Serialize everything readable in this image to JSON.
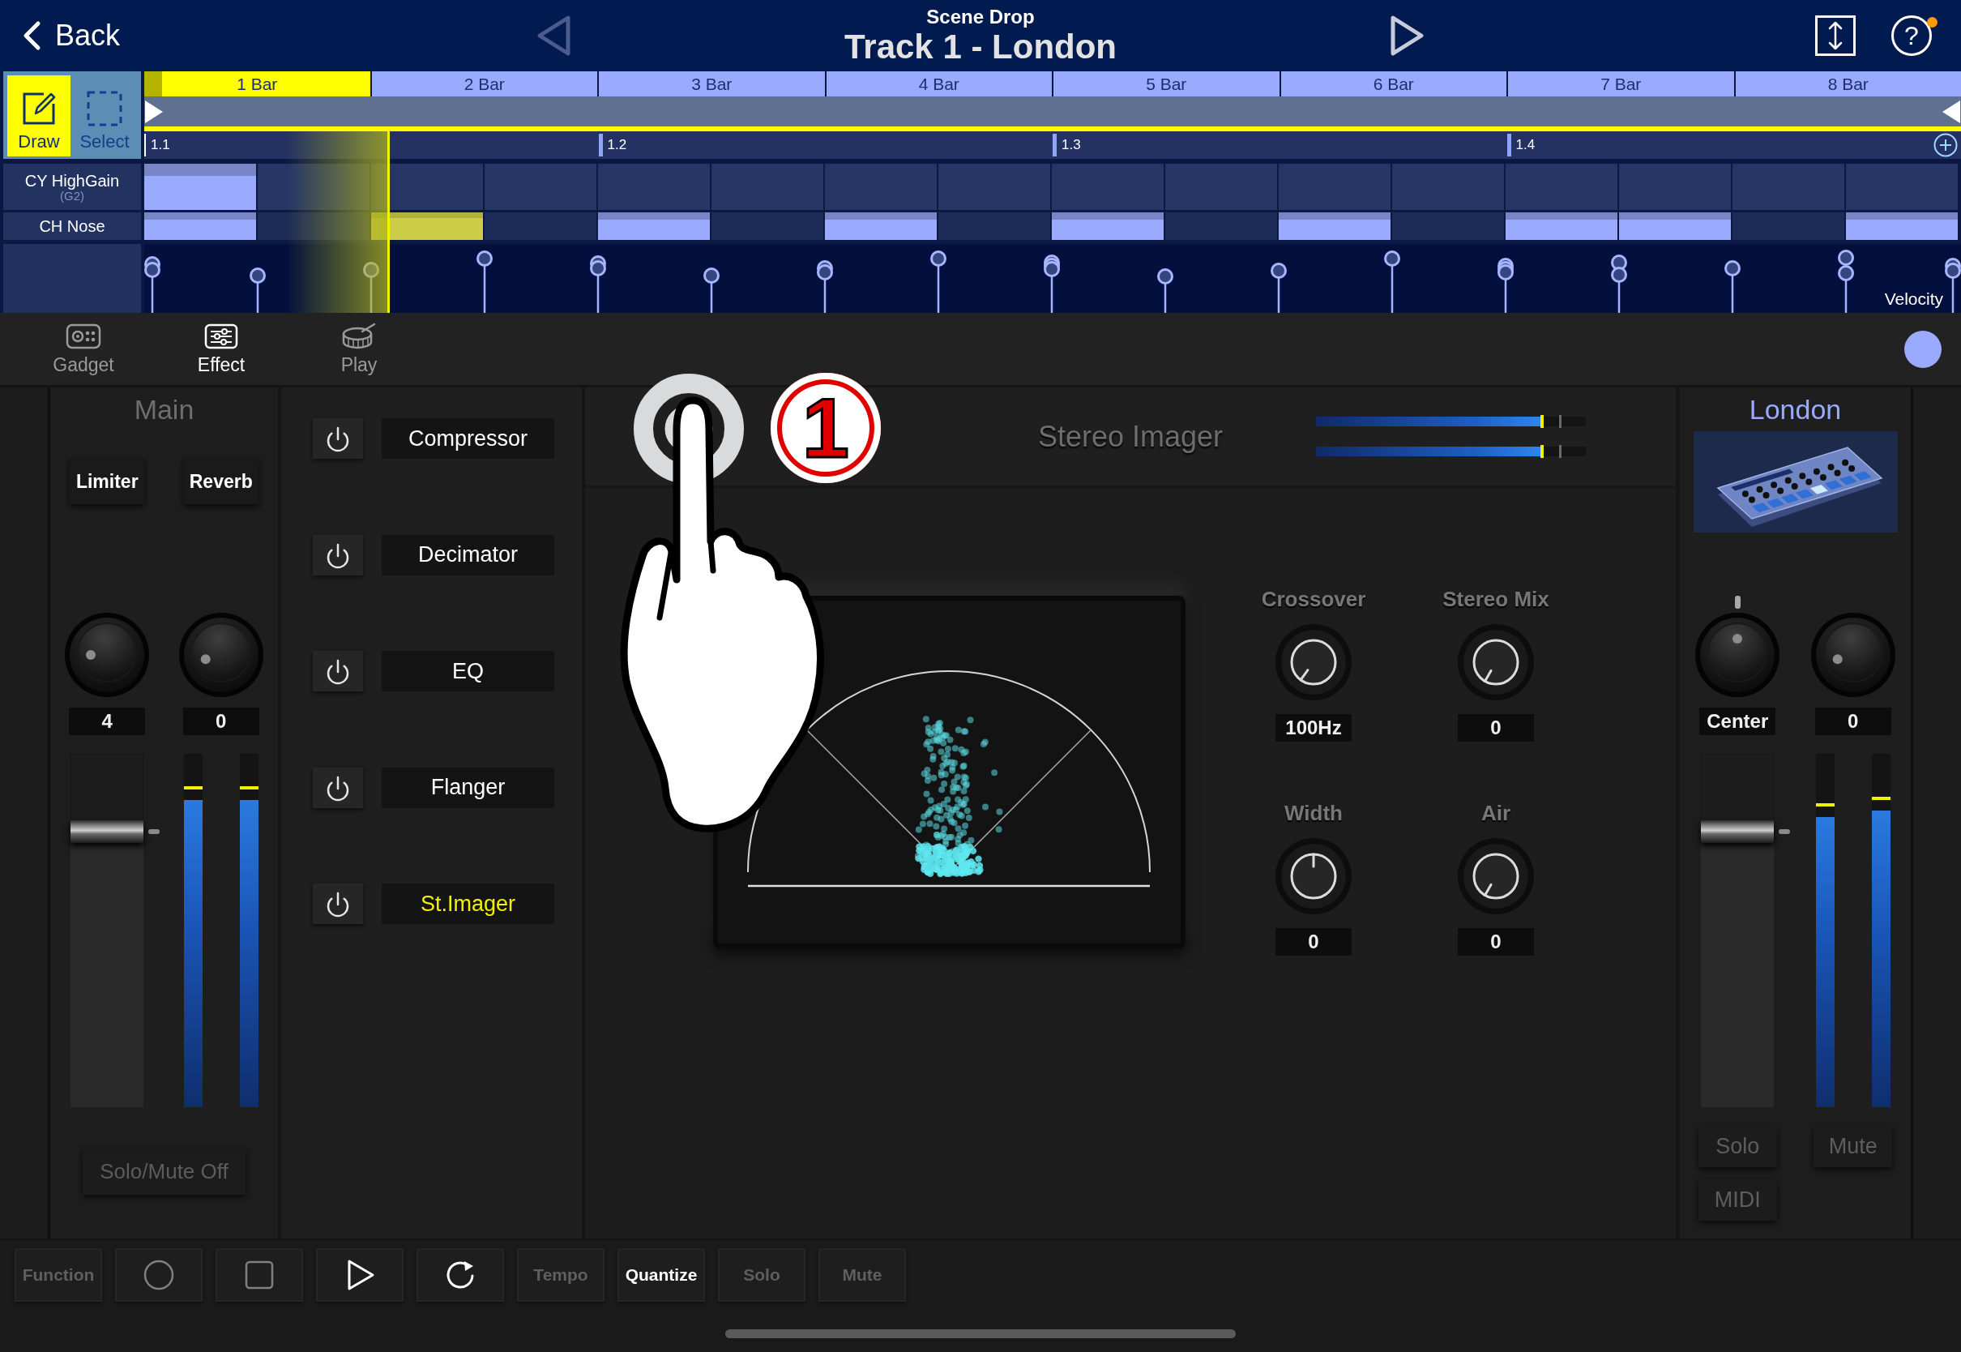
{
  "header": {
    "back_label": "Back",
    "subtitle": "Scene Drop",
    "title": "Track 1 - London",
    "previous_disabled": true,
    "next_disabled": false,
    "help_label": "?",
    "help_badge": true
  },
  "tools": [
    {
      "kind": "draw",
      "label": "Draw",
      "selected": true
    },
    {
      "kind": "select",
      "label": "Select",
      "selected": false
    }
  ],
  "bars": [
    {
      "label": "1 Bar",
      "selected": true
    },
    {
      "label": "2 Bar",
      "selected": false
    },
    {
      "label": "3 Bar",
      "selected": false
    },
    {
      "label": "4 Bar",
      "selected": false
    },
    {
      "label": "5 Bar",
      "selected": false
    },
    {
      "label": "6 Bar",
      "selected": false
    },
    {
      "label": "7 Bar",
      "selected": false
    },
    {
      "label": "8 Bar",
      "selected": false
    }
  ],
  "beats": [
    "1.1",
    "1.2",
    "1.3",
    "1.4"
  ],
  "tracks": [
    {
      "name": "CY HighGain",
      "note": "(G2)",
      "steps": [
        {
          "note": true,
          "selected": false
        },
        {
          "note": false,
          "selected": false
        },
        {
          "note": false,
          "selected": false
        },
        {
          "note": false,
          "selected": false
        },
        {
          "note": false,
          "selected": false
        },
        {
          "note": false,
          "selected": false
        },
        {
          "note": false,
          "selected": false
        },
        {
          "note": false,
          "selected": false
        },
        {
          "note": false,
          "selected": false
        },
        {
          "note": false,
          "selected": false
        },
        {
          "note": false,
          "selected": false
        },
        {
          "note": false,
          "selected": false
        },
        {
          "note": false,
          "selected": false
        },
        {
          "note": false,
          "selected": false
        },
        {
          "note": false,
          "selected": false
        },
        {
          "note": false,
          "selected": false
        }
      ]
    },
    {
      "name": "CH Nose",
      "steps": [
        {
          "note": true,
          "selected": false
        },
        {
          "note": false,
          "selected": false
        },
        {
          "note": true,
          "selected": true
        },
        {
          "note": false,
          "selected": false
        },
        {
          "note": true,
          "selected": false
        },
        {
          "note": false,
          "selected": false
        },
        {
          "note": true,
          "selected": false
        },
        {
          "note": false,
          "selected": false
        },
        {
          "note": true,
          "selected": false
        },
        {
          "note": false,
          "selected": false
        },
        {
          "note": true,
          "selected": false
        },
        {
          "note": false,
          "selected": false
        },
        {
          "note": true,
          "selected": false
        },
        {
          "note": true,
          "selected": false
        },
        {
          "note": false,
          "selected": false
        },
        {
          "note": true,
          "selected": false
        }
      ]
    }
  ],
  "playhead": {
    "level": 0.134
  },
  "velocity_label": "Velocity",
  "view_tabs": [
    {
      "kind": "gadget",
      "label": "Gadget",
      "selected": false
    },
    {
      "kind": "effect",
      "label": "Effect",
      "selected": true
    },
    {
      "kind": "play",
      "label": "Play",
      "selected": false
    }
  ],
  "main_channel": {
    "name": "Main",
    "sends": [
      {
        "label": "Limiter"
      },
      {
        "label": "Reverb"
      }
    ],
    "knobs": [
      {
        "kind": "send",
        "value": "4"
      },
      {
        "kind": "send",
        "value": "0"
      }
    ],
    "fader": {
      "level": 0.78
    },
    "meters": [
      {
        "level": 0.87
      },
      {
        "level": 0.87
      }
    ],
    "solo_mute_label": "Solo/Mute Off"
  },
  "effects": [
    {
      "name": "Compressor",
      "selected": false
    },
    {
      "name": "Decimator",
      "selected": false
    },
    {
      "name": "EQ",
      "selected": false
    },
    {
      "name": "Flanger",
      "selected": false
    },
    {
      "name": "St.Imager",
      "selected": true
    }
  ],
  "effect_panel": {
    "title": "Stereo Imager",
    "meters": [
      {
        "level": 0.84
      },
      {
        "level": 0.84
      }
    ],
    "params": [
      {
        "label": "Crossover",
        "value": "100Hz"
      },
      {
        "label": "Stereo Mix",
        "value": "0"
      },
      {
        "label": "Width",
        "value": "0"
      },
      {
        "label": "Air",
        "value": "0"
      }
    ]
  },
  "tutorial": {
    "step": "1"
  },
  "gadget_channel": {
    "name": "London",
    "thumbnail": true,
    "knobs": [
      {
        "kind": "pan",
        "value": "Center"
      },
      {
        "kind": "send",
        "value": "0"
      }
    ],
    "fader": {
      "level": 0.78
    },
    "meters": [
      {
        "level": 0.82
      },
      {
        "level": 0.84
      }
    ],
    "buttons": [
      {
        "label": "Solo",
        "on": false
      },
      {
        "label": "Mute",
        "on": false
      },
      {
        "label": "MIDI",
        "on": false
      }
    ]
  },
  "transport": [
    {
      "kind": "text",
      "label": "Function",
      "on": false
    },
    {
      "kind": "record",
      "on": false
    },
    {
      "kind": "stop",
      "on": false
    },
    {
      "kind": "play",
      "on": true
    },
    {
      "kind": "loop",
      "on": true
    },
    {
      "kind": "text",
      "label": "Tempo",
      "on": false
    },
    {
      "kind": "text",
      "label": "Quantize",
      "on": true
    },
    {
      "kind": "text",
      "label": "Solo",
      "on": false
    },
    {
      "kind": "text",
      "label": "Mute",
      "on": false
    }
  ]
}
